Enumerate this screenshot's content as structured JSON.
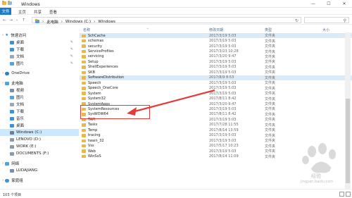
{
  "window": {
    "title": "Windows",
    "controls": {
      "minimize": "—",
      "maximize": "☐",
      "close": "✕"
    }
  },
  "ribbon": {
    "tabs": [
      "文件",
      "主页",
      "共享",
      "查看"
    ]
  },
  "nav": {
    "back": "←",
    "forward": "→",
    "up": "↑",
    "dropdown": "⌄",
    "refresh": "↻"
  },
  "address": {
    "separator": "›",
    "crumbs": [
      "此电脑",
      "Windows (C:)",
      "Windows"
    ],
    "refresh": "↻"
  },
  "search": {
    "icon": "⚲"
  },
  "sidebar": {
    "expand_glyph": "›",
    "quick_access": "快速访问",
    "quick_items": [
      {
        "label": "桌面",
        "icon": "desktop-icon",
        "pinned": true
      },
      {
        "label": "下载",
        "icon": "download-icon",
        "pinned": true
      },
      {
        "label": "文档",
        "icon": "document-icon",
        "pinned": true
      },
      {
        "label": "图片",
        "icon": "picture-icon",
        "pinned": true
      }
    ],
    "onedrive": "OneDrive",
    "this_pc": "此电脑",
    "pc_items": [
      "视频",
      "图片",
      "文档",
      "下载",
      "音乐",
      "桌面"
    ],
    "drives": [
      "Windows (C:)",
      "LENOVO (D:)",
      "WORK (E:)",
      "DOCUMENTS (F:)"
    ],
    "network": "网络",
    "network_items": [
      "LUDAJIANG"
    ],
    "homegroup": "家庭组"
  },
  "columns": {
    "name": "名称",
    "date": "修改日期",
    "type": "类型",
    "size": "大小",
    "sort_indicator": "^"
  },
  "files": [
    {
      "name": "SchCache",
      "date": "2017/3/19 5:03",
      "type": "文件夹",
      "selected": true
    },
    {
      "name": "schemas",
      "date": "2017/3/19 5:03",
      "type": "文件夹"
    },
    {
      "name": "security",
      "date": "2017/3/19 5:03",
      "type": "文件夹"
    },
    {
      "name": "ServiceProfiles",
      "date": "2017/3/23 10:28",
      "type": "文件夹"
    },
    {
      "name": "servicing",
      "date": "2017/3/20 9:47",
      "type": "文件夹"
    },
    {
      "name": "Setup",
      "date": "2017/3/19 5:03",
      "type": "文件夹"
    },
    {
      "name": "ShellExperiences",
      "date": "2017/3/19 5:03",
      "type": "文件夹"
    },
    {
      "name": "SKB",
      "date": "2017/3/19 5:03",
      "type": "文件夹"
    },
    {
      "name": "SoftwareDistribution",
      "date": "2017/8/9 8:53",
      "type": "文件夹",
      "selected": true
    },
    {
      "name": "Speech",
      "date": "2017/3/19 5:03",
      "type": "文件夹"
    },
    {
      "name": "Speech_OneCore",
      "date": "2017/3/19 5:03",
      "type": "文件夹"
    },
    {
      "name": "System",
      "date": "2017/3/19 5:03",
      "type": "文件夹"
    },
    {
      "name": "System32",
      "date": "2017/8/11 8:42",
      "type": "文件夹"
    },
    {
      "name": "SystemApps",
      "date": "2017/3/20 9:47",
      "type": "文件夹"
    },
    {
      "name": "SystemResources",
      "date": "2017/3/19 5:03",
      "type": "文件夹"
    },
    {
      "name": "SysWOW64",
      "date": "2017/8/11 8:42",
      "type": "文件夹"
    },
    {
      "name": "TAPI",
      "date": "2017/3/19 5:03",
      "type": "文件夹"
    },
    {
      "name": "Tasks",
      "date": "2017/7/28 11:55",
      "type": "文件夹"
    },
    {
      "name": "Temp",
      "date": "2017/8/14 13:59",
      "type": "文件夹"
    },
    {
      "name": "tracing",
      "date": "2017/3/19 5:03",
      "type": "文件夹"
    },
    {
      "name": "twain_32",
      "date": "2017/3/19 5:03",
      "type": "文件夹"
    },
    {
      "name": "Vss",
      "date": "2017/5/17 10:23",
      "type": "文件夹"
    },
    {
      "name": "Web",
      "date": "2017/3/19 5:03",
      "type": "文件夹"
    },
    {
      "name": "WinSxS",
      "date": "2017/8/14 11:09",
      "type": "文件夹"
    }
  ],
  "status": {
    "text": "103 个项目"
  },
  "watermark": {
    "text": "经验",
    "site": "jingyan.baidu.com"
  },
  "colors": {
    "accent": "#1979ca",
    "selection": "#cce8ff",
    "folder": "#e8b84a",
    "annotation": "#e33b3b"
  }
}
